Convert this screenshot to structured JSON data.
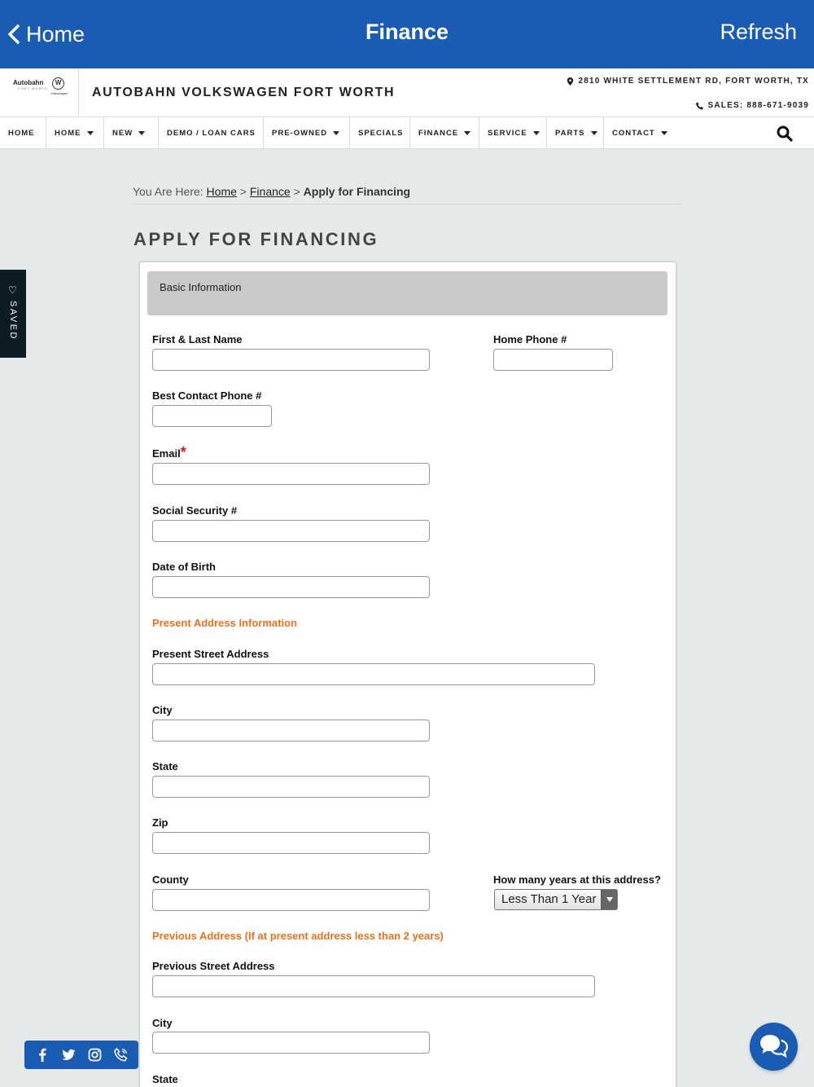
{
  "appbar": {
    "back_label": "Home",
    "title": "Finance",
    "refresh_label": "Refresh"
  },
  "dealer": {
    "logo_brand": "Autobahn",
    "logo_sub": "FORT WORTH",
    "logo_vw": "Volkswagen",
    "name": "AUTOBAHN VOLKSWAGEN FORT WORTH",
    "address": "2810 WHITE SETTLEMENT RD, FORT WORTH, TX",
    "sales": "SALES: 888-671-9039"
  },
  "nav": {
    "items": [
      {
        "label": "HOME",
        "caret": false
      },
      {
        "label": "HOME",
        "caret": true
      },
      {
        "label": "NEW",
        "caret": true
      },
      {
        "label": "DEMO / LOAN CARS",
        "caret": false
      },
      {
        "label": "PRE-OWNED",
        "caret": true
      },
      {
        "label": "SPECIALS",
        "caret": false
      },
      {
        "label": "FINANCE",
        "caret": true
      },
      {
        "label": "SERVICE",
        "caret": true
      },
      {
        "label": "PARTS",
        "caret": true
      },
      {
        "label": "CONTACT",
        "caret": true
      }
    ]
  },
  "breadcrumb": {
    "prefix": "You Are Here:",
    "home": "Home",
    "sep": ">",
    "finance": "Finance",
    "current": "Apply for Financing"
  },
  "page_title": "APPLY FOR FINANCING",
  "saved_tab": {
    "label": "SAVED"
  },
  "form": {
    "section_title": "Basic Information",
    "fields": {
      "name": {
        "label": "First & Last Name",
        "value": ""
      },
      "home_phone": {
        "label": "Home Phone #",
        "value": ""
      },
      "best_phone": {
        "label": "Best Contact Phone #",
        "value": ""
      },
      "email": {
        "label": "Email",
        "required_mark": "*",
        "value": ""
      },
      "ssn": {
        "label": "Social Security #",
        "value": ""
      },
      "dob": {
        "label": "Date of Birth",
        "value": ""
      },
      "present_street": {
        "label": "Present Street Address",
        "value": ""
      },
      "city": {
        "label": "City",
        "value": ""
      },
      "state": {
        "label": "State",
        "value": ""
      },
      "zip": {
        "label": "Zip",
        "value": ""
      },
      "county": {
        "label": "County",
        "value": ""
      },
      "years": {
        "label": "How many years at this address?",
        "selected": "Less Than 1 Year"
      },
      "prev_street": {
        "label": "Previous Street Address",
        "value": ""
      },
      "prev_city": {
        "label": "City",
        "value": ""
      },
      "prev_state": {
        "label": "State"
      }
    },
    "present_heading": "Present Address Information",
    "previous_heading": "Previous Address (If at present address less than 2 years)"
  },
  "social": {
    "icons": [
      "facebook-icon",
      "twitter-icon",
      "instagram-icon",
      "phone-icon"
    ]
  },
  "colors": {
    "brand_blue": "#1a5bb4",
    "orange": "#e8721b",
    "required_red": "#dd1111"
  }
}
